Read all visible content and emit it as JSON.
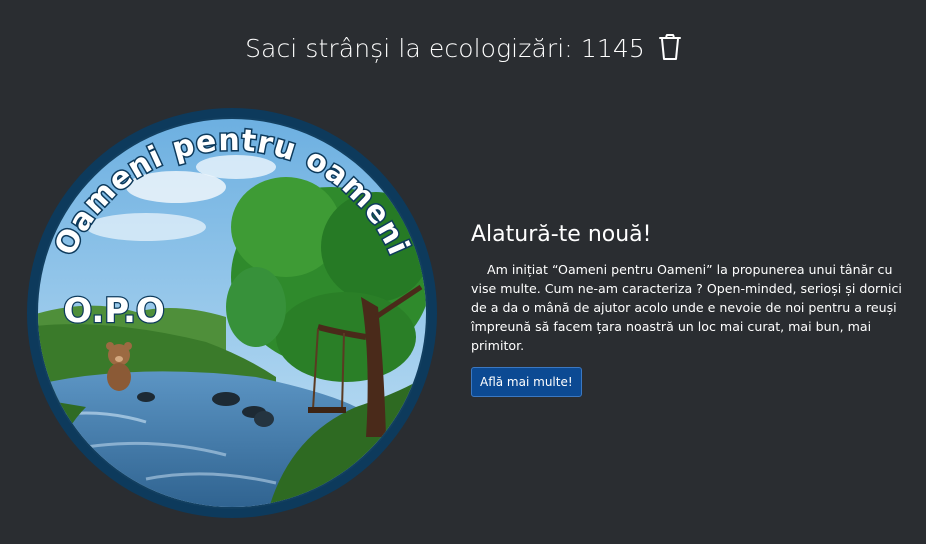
{
  "counter": {
    "label": "Saci strânși la ecologizări: 1145",
    "icon": "trash-icon"
  },
  "logo": {
    "arc_text": "Oameni pentru oameni",
    "short_text": "O.P.O",
    "colors": {
      "ring": "#0d3a5c",
      "sky": "#8fc4ea",
      "tree": "#2f8a2c",
      "water": "#3f77a8",
      "grass": "#3a7a2a"
    }
  },
  "main": {
    "heading": "Alatură-te nouă!",
    "body": "Am inițiat “Oameni pentru Oameni” la propunerea unui tânăr cu vise multe. Cum ne-am caracteriza ? Open-minded, serioși și dornici de a da o mână de ajutor acolo unde e nevoie de noi pentru a reuși împreună să facem țara noastră un loc mai curat, mai bun, mai primitor.",
    "button_label": "Află mai multe!"
  },
  "colors": {
    "background": "#2a2d31",
    "button_bg": "#0c4a93",
    "button_border": "#3b78c2"
  }
}
